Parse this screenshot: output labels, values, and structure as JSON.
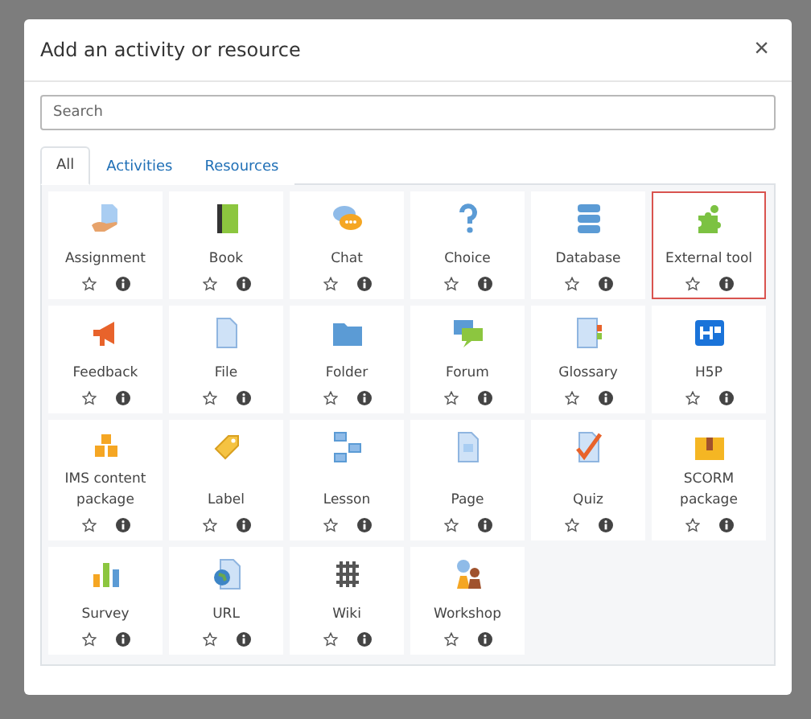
{
  "dialog": {
    "title": "Add an activity or resource",
    "close": "×"
  },
  "search": {
    "placeholder": "Search"
  },
  "tabs": [
    {
      "label": "All",
      "selected": true
    },
    {
      "label": "Activities",
      "selected": false
    },
    {
      "label": "Resources",
      "selected": false
    }
  ],
  "items": [
    {
      "label": "Assignment",
      "highlighted": false
    },
    {
      "label": "Book",
      "highlighted": false
    },
    {
      "label": "Chat",
      "highlighted": false
    },
    {
      "label": "Choice",
      "highlighted": false
    },
    {
      "label": "Database",
      "highlighted": false
    },
    {
      "label": "External tool",
      "highlighted": true
    },
    {
      "label": "Feedback",
      "highlighted": false
    },
    {
      "label": "File",
      "highlighted": false
    },
    {
      "label": "Folder",
      "highlighted": false
    },
    {
      "label": "Forum",
      "highlighted": false
    },
    {
      "label": "Glossary",
      "highlighted": false
    },
    {
      "label": "H5P",
      "highlighted": false
    },
    {
      "label": "IMS content package",
      "highlighted": false
    },
    {
      "label": "Label",
      "highlighted": false
    },
    {
      "label": "Lesson",
      "highlighted": false
    },
    {
      "label": "Page",
      "highlighted": false
    },
    {
      "label": "Quiz",
      "highlighted": false
    },
    {
      "label": "SCORM package",
      "highlighted": false
    },
    {
      "label": "Survey",
      "highlighted": false
    },
    {
      "label": "URL",
      "highlighted": false
    },
    {
      "label": "Wiki",
      "highlighted": false
    },
    {
      "label": "Workshop",
      "highlighted": false
    }
  ]
}
